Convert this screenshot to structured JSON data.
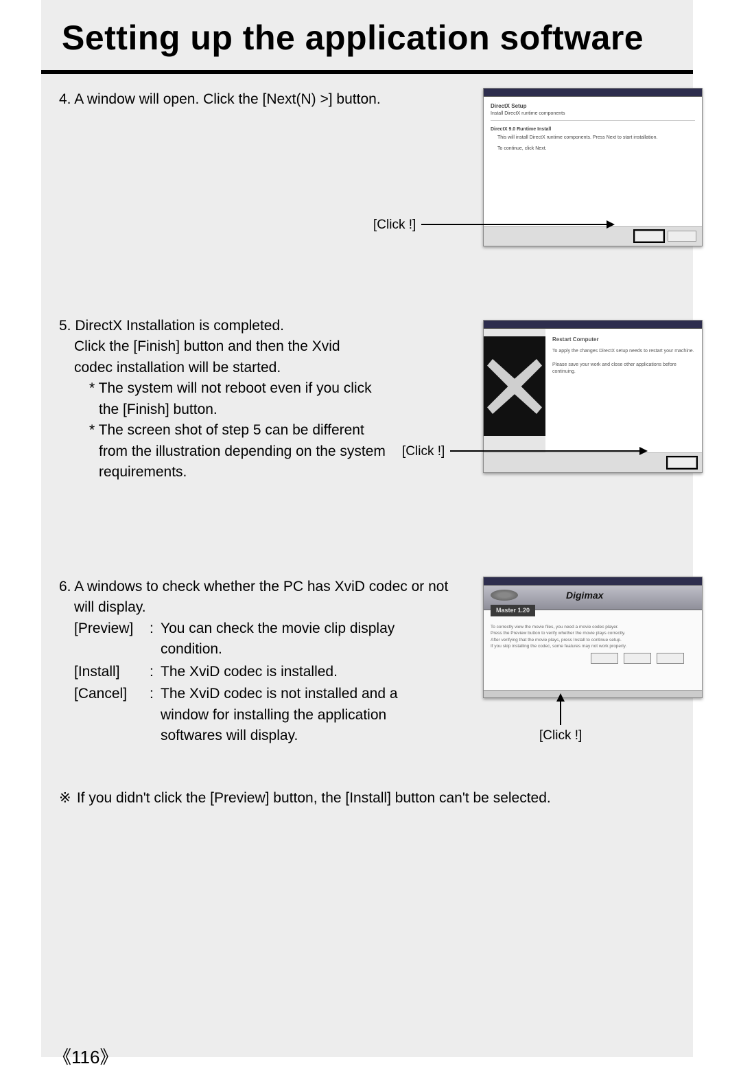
{
  "title": "Setting up the application software",
  "step4": {
    "num": "4.",
    "text": "A window will open. Click the [Next(N) >] button.",
    "click_label": "[Click !]",
    "fig": {
      "heading": "DirectX Setup",
      "sub": "Install DirectX runtime components",
      "section": "DirectX 9.0 Runtime Install",
      "line1": "This will install DirectX runtime components. Press Next to start installation.",
      "line2": "To continue, click Next."
    }
  },
  "step5": {
    "num": "5.",
    "line1": "DirectX Installation is completed.",
    "line2": "Click the [Finish] button and then the Xvid",
    "line3": "codec installation will be started.",
    "note1a": "* The system will not reboot even if you click",
    "note1b": "the [Finish] button.",
    "note2a": "* The screen shot of step 5 can be different",
    "note2b": "from the illustration depending on the system",
    "note2c": "requirements.",
    "click_label": "[Click !]",
    "fig": {
      "heading": "Restart Computer",
      "line1": "To apply the changes DirectX setup needs to restart your machine.",
      "line2": "Please save your work and close other applications before continuing."
    }
  },
  "step6": {
    "num": "6.",
    "intro1": "A windows to check whether the PC has XviD codec or not",
    "intro2": "will display.",
    "preview_term": "[Preview]",
    "preview_desc": "You can check the movie clip display condition.",
    "install_term": "[Install]",
    "install_desc": "The XviD codec is installed.",
    "cancel_term": "[Cancel]",
    "cancel_desc": "The XviD codec is not installed and a window for installing the application softwares will display.",
    "click_label": "[Click !]",
    "fig": {
      "brand": "Digimax",
      "sub": "Master 1.20",
      "body1": "To correctly view the movie files, you need a movie codec player.",
      "body2": "Press the Preview button to verify whether the movie plays correctly.",
      "body3": "After verifying that the movie plays, press Install to continue setup.",
      "body4": "If you skip installing the codec, some features may not work properly."
    }
  },
  "footnote": {
    "mark": "※",
    "text": "If you didn't click the [Preview] button, the [Install] button can't be selected."
  },
  "page_number": "116"
}
